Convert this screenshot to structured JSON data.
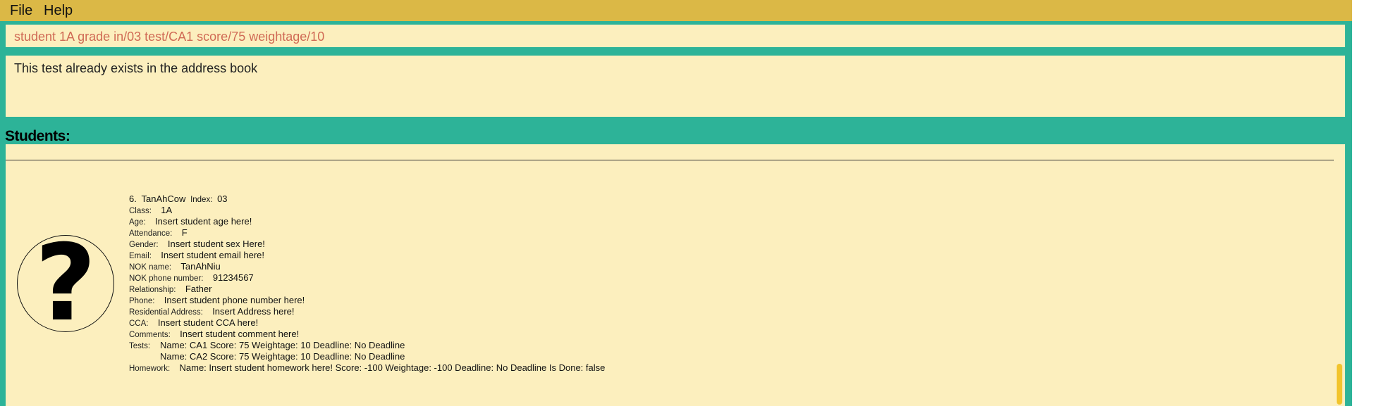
{
  "menu": {
    "file": "File",
    "help": "Help"
  },
  "command_box": {
    "value": "student 1A grade in/03 test/CA1 score/75 weightage/10"
  },
  "result_box": {
    "message": "This test already exists in the address book"
  },
  "list": {
    "title": "Students:"
  },
  "student": {
    "number": "6.",
    "name": "TanAhCow",
    "index_label": "Index:",
    "index_value": "03",
    "fields": [
      {
        "label": "Class:",
        "value": "1A"
      },
      {
        "label": "Age:",
        "value": "Insert student age here!"
      },
      {
        "label": "Attendance:",
        "value": "F"
      },
      {
        "label": "Gender:",
        "value": "Insert student sex Here!"
      },
      {
        "label": "Email:",
        "value": "Insert student email here!"
      },
      {
        "label": "NOK name:",
        "value": "TanAhNiu"
      },
      {
        "label": "NOK phone number:",
        "value": "91234567"
      },
      {
        "label": "Relationship:",
        "value": "Father"
      },
      {
        "label": "Phone:",
        "value": "Insert student phone number here!"
      },
      {
        "label": "Residential Address:",
        "value": "Insert Address here!"
      },
      {
        "label": "CCA:",
        "value": "Insert student CCA here!"
      },
      {
        "label": "Comments:",
        "value": "Insert student comment here!"
      }
    ],
    "tests_label": "Tests:",
    "tests": [
      "Name: CA1 Score: 75 Weightage: 10 Deadline: No Deadline",
      "Name: CA2 Score: 75 Weightage: 10 Deadline: No Deadline"
    ],
    "homework_label": "Homework:",
    "homework": "Name: Insert student homework here! Score: -100 Weightage: -100 Deadline: No Deadline Is Done: false",
    "avatar_icon": "question-mark-icon",
    "avatar_glyph": "?"
  }
}
